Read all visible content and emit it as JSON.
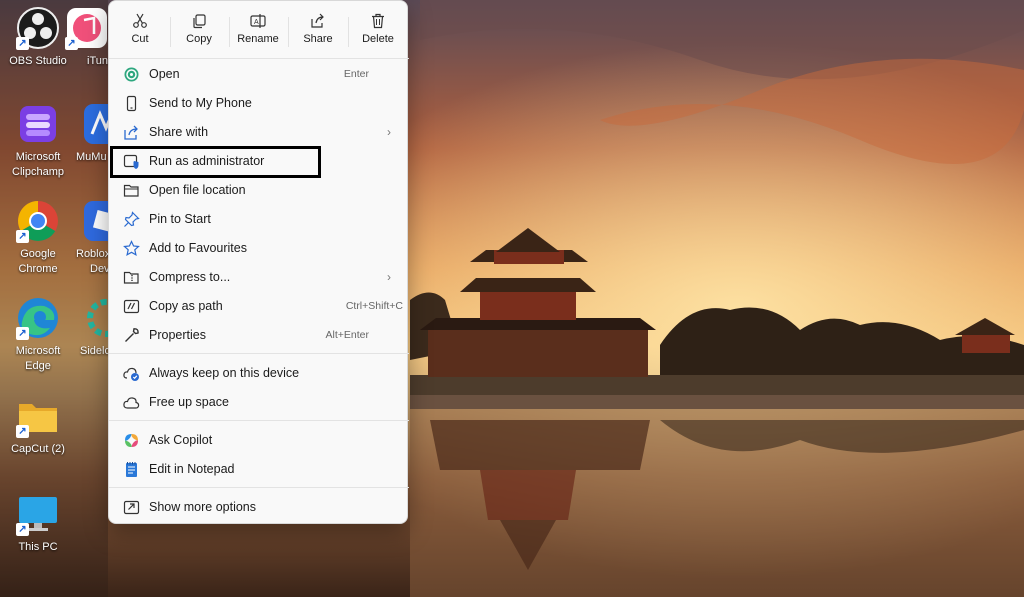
{
  "desktop": {
    "icons": [
      {
        "label": "OBS Studio",
        "icon": "obs-icon"
      },
      {
        "label": "iTun",
        "icon": "itunes-icon"
      },
      {
        "label": "Microsoft Clipchamp",
        "label_line1": "Microsoft",
        "label_line2": "Clipchamp",
        "icon": "clipchamp-icon"
      },
      {
        "label": "MuMu",
        "icon": "mumu-icon"
      },
      {
        "label": "Google Chrome",
        "label_line1": "Google",
        "label_line2": "Chrome",
        "icon": "chrome-icon"
      },
      {
        "label": "Roblox Devi",
        "label_line1": "Roblox",
        "label_line2": "Devi",
        "icon": "roblox-icon"
      },
      {
        "label": "Microsoft Edge",
        "label_line1": "Microsoft",
        "label_line2": "Edge",
        "icon": "edge-icon"
      },
      {
        "label": "Sidelo",
        "icon": "sideloadly-icon"
      },
      {
        "label": "CapCut (2)",
        "icon": "folder-icon"
      },
      {
        "label": "This PC",
        "icon": "monitor-icon"
      }
    ]
  },
  "context_menu": {
    "quick_actions": [
      {
        "label": "Cut",
        "icon": "scissors-icon"
      },
      {
        "label": "Copy",
        "icon": "copy-icon"
      },
      {
        "label": "Rename",
        "icon": "rename-icon"
      },
      {
        "label": "Share",
        "icon": "share-icon"
      },
      {
        "label": "Delete",
        "icon": "trash-icon"
      }
    ],
    "items": [
      {
        "label": "Open",
        "accelerator": "Enter",
        "icon": "open-app-icon"
      },
      {
        "label": "Send to My Phone",
        "icon": "phone-icon"
      },
      {
        "label": "Share with",
        "submenu": true,
        "icon": "share-with-icon"
      },
      {
        "label": "Run as administrator",
        "icon": "shield-admin-icon"
      },
      {
        "label": "Open file location",
        "icon": "folder-open-icon"
      },
      {
        "label": "Pin to Start",
        "icon": "pin-icon"
      },
      {
        "label": "Add to Favourites",
        "icon": "star-icon"
      },
      {
        "label": "Compress to...",
        "submenu": true,
        "icon": "zip-folder-icon"
      },
      {
        "label": "Copy as path",
        "accelerator": "Ctrl+Shift+C",
        "icon": "copy-path-icon"
      },
      {
        "label": "Properties",
        "accelerator": "Alt+Enter",
        "icon": "wrench-icon"
      },
      {
        "label": "Always keep on this device",
        "icon": "cloud-sync-icon"
      },
      {
        "label": "Free up space",
        "icon": "cloud-icon"
      },
      {
        "label": "Ask Copilot",
        "icon": "copilot-icon"
      },
      {
        "label": "Edit in Notepad",
        "icon": "notepad-icon"
      },
      {
        "label": "Show more options",
        "icon": "more-options-icon"
      }
    ],
    "submenu_chevron": "›"
  },
  "colors": {
    "accent_blue": "#1a5fd0",
    "menu_bg": "#f9f9f9",
    "highlight_border": "#000000"
  }
}
